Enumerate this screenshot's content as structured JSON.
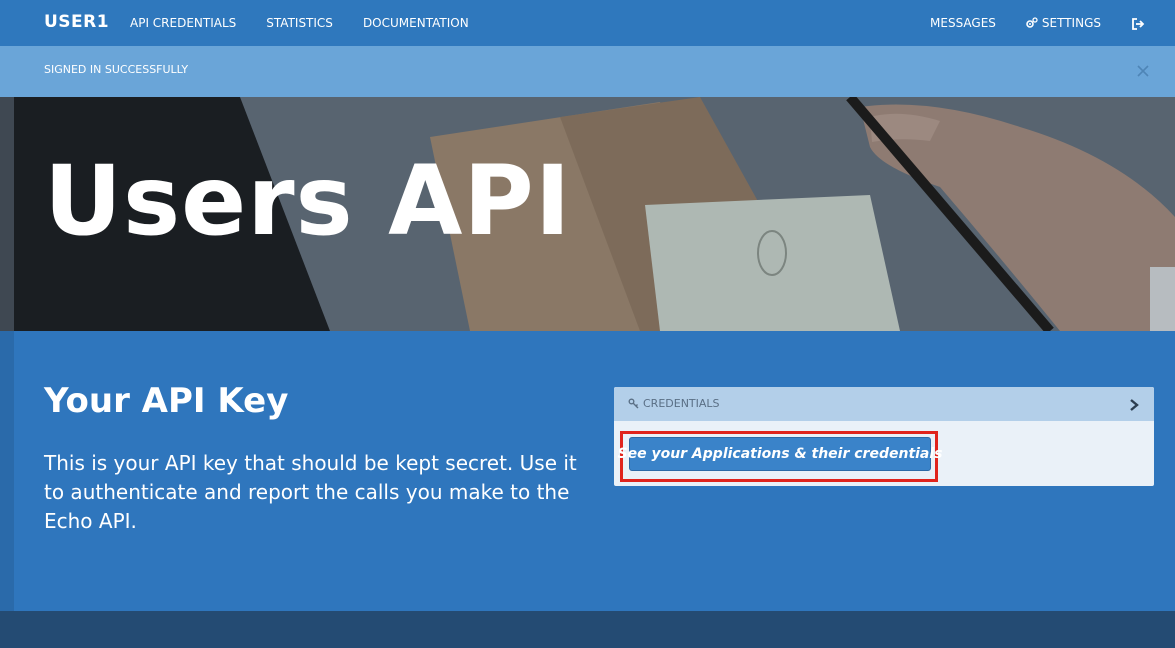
{
  "navbar": {
    "brand": "USER1",
    "links": [
      "API CREDENTIALS",
      "STATISTICS",
      "DOCUMENTATION"
    ],
    "messages": "MESSAGES",
    "settings": "SETTINGS",
    "icons": {
      "settings": "gears-icon",
      "logout": "sign-out-icon"
    }
  },
  "flash": {
    "message": "SIGNED IN SUCCESSFULLY",
    "close_icon": "close-icon"
  },
  "hero": {
    "title": "Users API"
  },
  "api_key_section": {
    "title": "Your API Key",
    "description": "This is your API key that should be kept secret. Use it to authenticate and report the calls you make to the Echo API."
  },
  "credentials_panel": {
    "header": "CREDENTIALS",
    "header_icon": "key-icon",
    "expand_icon": "chevron-right-icon",
    "button_label": "See your Applications & their credentials"
  },
  "colors": {
    "navbar": "#2f78bd",
    "flash": "#6aa5d8",
    "main": "#2f76bd",
    "highlight": "#e0241d",
    "button": "#3a83c9",
    "footer": "#244b73"
  }
}
